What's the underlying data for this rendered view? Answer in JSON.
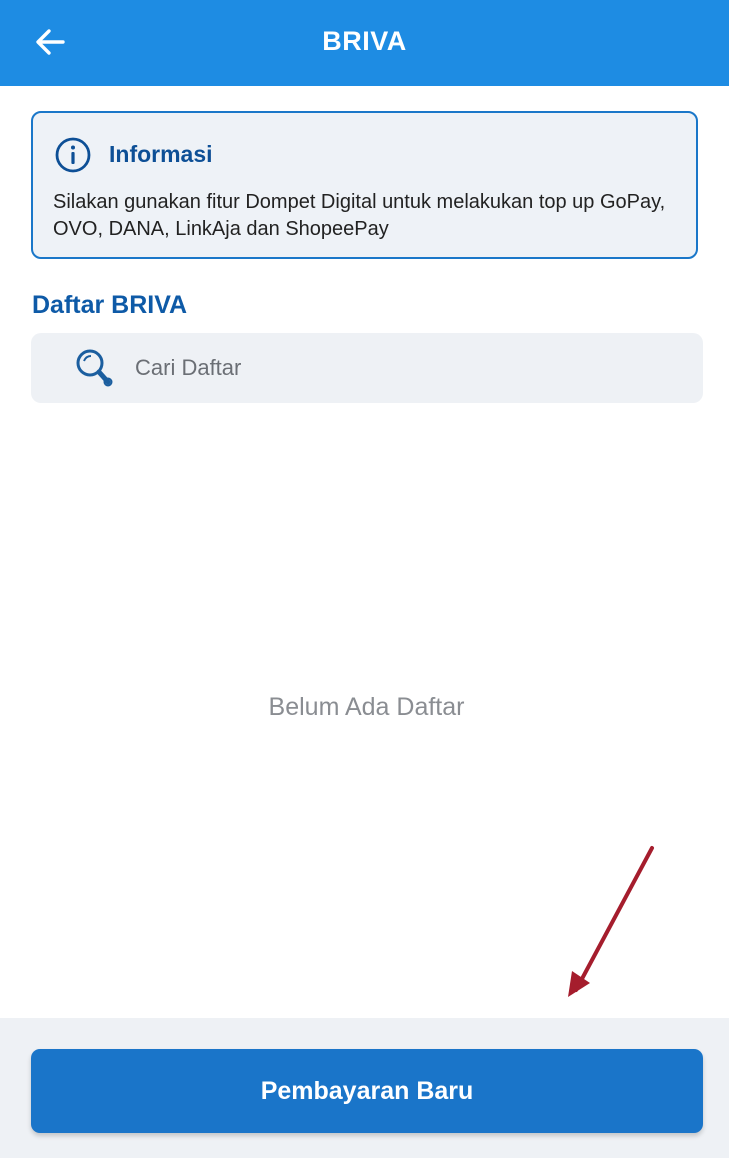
{
  "header": {
    "title": "BRIVA",
    "back_icon": "arrow-left-icon",
    "color": "#1e8ce3"
  },
  "info_box": {
    "icon": "info-circle-icon",
    "title": "Informasi",
    "text": "Silakan gunakan fitur Dompet Digital untuk melakukan top up GoPay, OVO, DANA, LinkAja dan ShopeePay"
  },
  "list": {
    "title": "Daftar BRIVA",
    "search_icon": "search-icon",
    "search_placeholder": "Cari Daftar",
    "search_value": "",
    "empty_message": "Belum Ada Daftar"
  },
  "footer": {
    "button_label": "Pembayaran Baru",
    "button_color": "#1a75c9"
  },
  "annotation": {
    "icon": "red-arrow-icon",
    "color": "#a51d2d"
  }
}
